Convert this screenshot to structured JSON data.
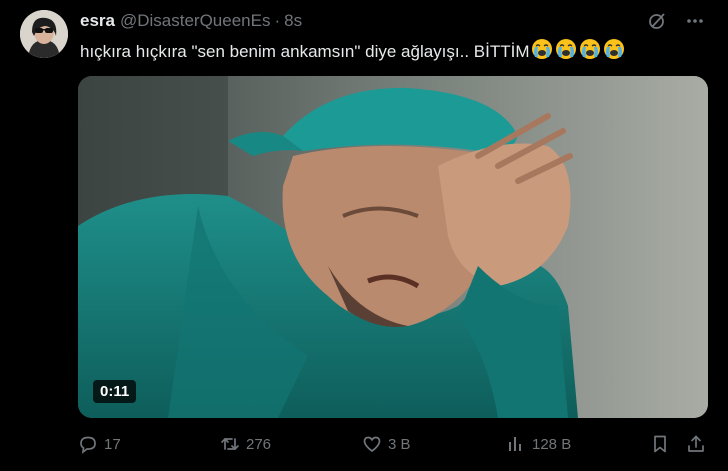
{
  "user": {
    "name": "esra",
    "handle": "@DisasterQueenEs",
    "separator": "·",
    "time": "8s"
  },
  "tweet": {
    "text": "hıçkıra hıçkıra \"sen benim ankamsın\" diye ağlayışı.. BİTTİM",
    "emoji_icons": [
      "loudly-crying-face-icon",
      "loudly-crying-face-icon",
      "loudly-crying-face-icon",
      "loudly-crying-face-icon"
    ]
  },
  "video": {
    "duration": "0:11"
  },
  "actions": {
    "replies": "17",
    "reposts": "276",
    "likes": "3 B",
    "views": "128 B"
  },
  "icons": {
    "top": [
      "grok-icon",
      "more-icon"
    ],
    "actions": [
      "reply-icon",
      "repost-icon",
      "like-icon",
      "views-icon",
      "bookmark-icon",
      "share-icon"
    ]
  },
  "colors": {
    "background": "#000000",
    "text": "#e7e9ea",
    "secondary": "#71767b"
  }
}
